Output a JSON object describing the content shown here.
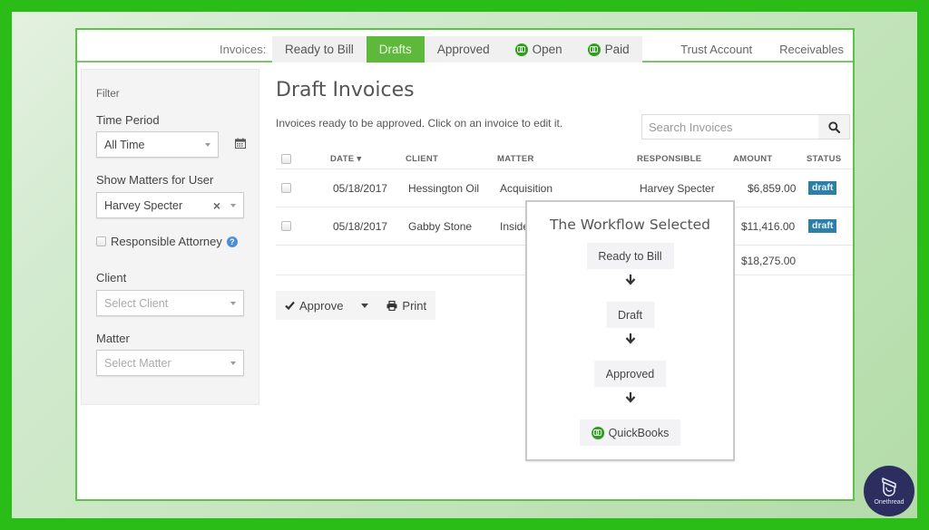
{
  "colors": {
    "frame_green": "#2bbd17",
    "active_tab": "#5db83c",
    "badge_blue": "#2e7fa8",
    "quickbooks_green": "#2ca01c",
    "logo_navy": "#2b2e5e"
  },
  "nav": {
    "label": "Invoices:",
    "tabs": [
      {
        "label": "Ready to Bill",
        "active": false,
        "icon": null
      },
      {
        "label": "Drafts",
        "active": true,
        "icon": null
      },
      {
        "label": "Approved",
        "active": false,
        "icon": null
      },
      {
        "label": "Open",
        "active": false,
        "icon": "quickbooks-icon"
      },
      {
        "label": "Paid",
        "active": false,
        "icon": "quickbooks-icon"
      }
    ],
    "right_links": [
      "Trust Account",
      "Receivables"
    ]
  },
  "sidebar": {
    "title": "Filter",
    "time_period": {
      "label": "Time Period",
      "value": "All Time",
      "icon": "calendar-icon"
    },
    "show_matters": {
      "label": "Show Matters for User",
      "value": "Harvey Specter",
      "clear_icon": "×"
    },
    "responsible_attorney": {
      "label": "Responsible Attorney",
      "checked": false,
      "help_icon": "?"
    },
    "client": {
      "label": "Client",
      "placeholder": "Select Client"
    },
    "matter": {
      "label": "Matter",
      "placeholder": "Select Matter"
    }
  },
  "main": {
    "title": "Draft Invoices",
    "subtitle": "Invoices ready to be approved. Click on an invoice to edit it.",
    "search_placeholder": "Search Invoices",
    "columns": {
      "date": "DATE",
      "date_sort": "▾",
      "client": "CLIENT",
      "matter": "MATTER",
      "responsible": "RESPONSIBLE",
      "amount": "AMOUNT",
      "status": "STATUS"
    },
    "rows": [
      {
        "date": "05/18/2017",
        "client": "Hessington Oil",
        "matter": "Acquisition",
        "responsible": "Harvey Specter",
        "amount": "$6,859.00",
        "status": "draft"
      },
      {
        "date": "05/18/2017",
        "client": "Gabby Stone",
        "matter": "Inside",
        "responsible": "",
        "amount": "$11,416.00",
        "status": "draft"
      }
    ],
    "total": "$18,275.00",
    "actions": {
      "approve": "Approve",
      "print": "Print"
    }
  },
  "workflow": {
    "title": "The Workflow Selected",
    "steps": [
      "Ready to Bill",
      "Draft",
      "Approved",
      "QuickBooks"
    ]
  },
  "logo": {
    "text": "Onethread"
  }
}
